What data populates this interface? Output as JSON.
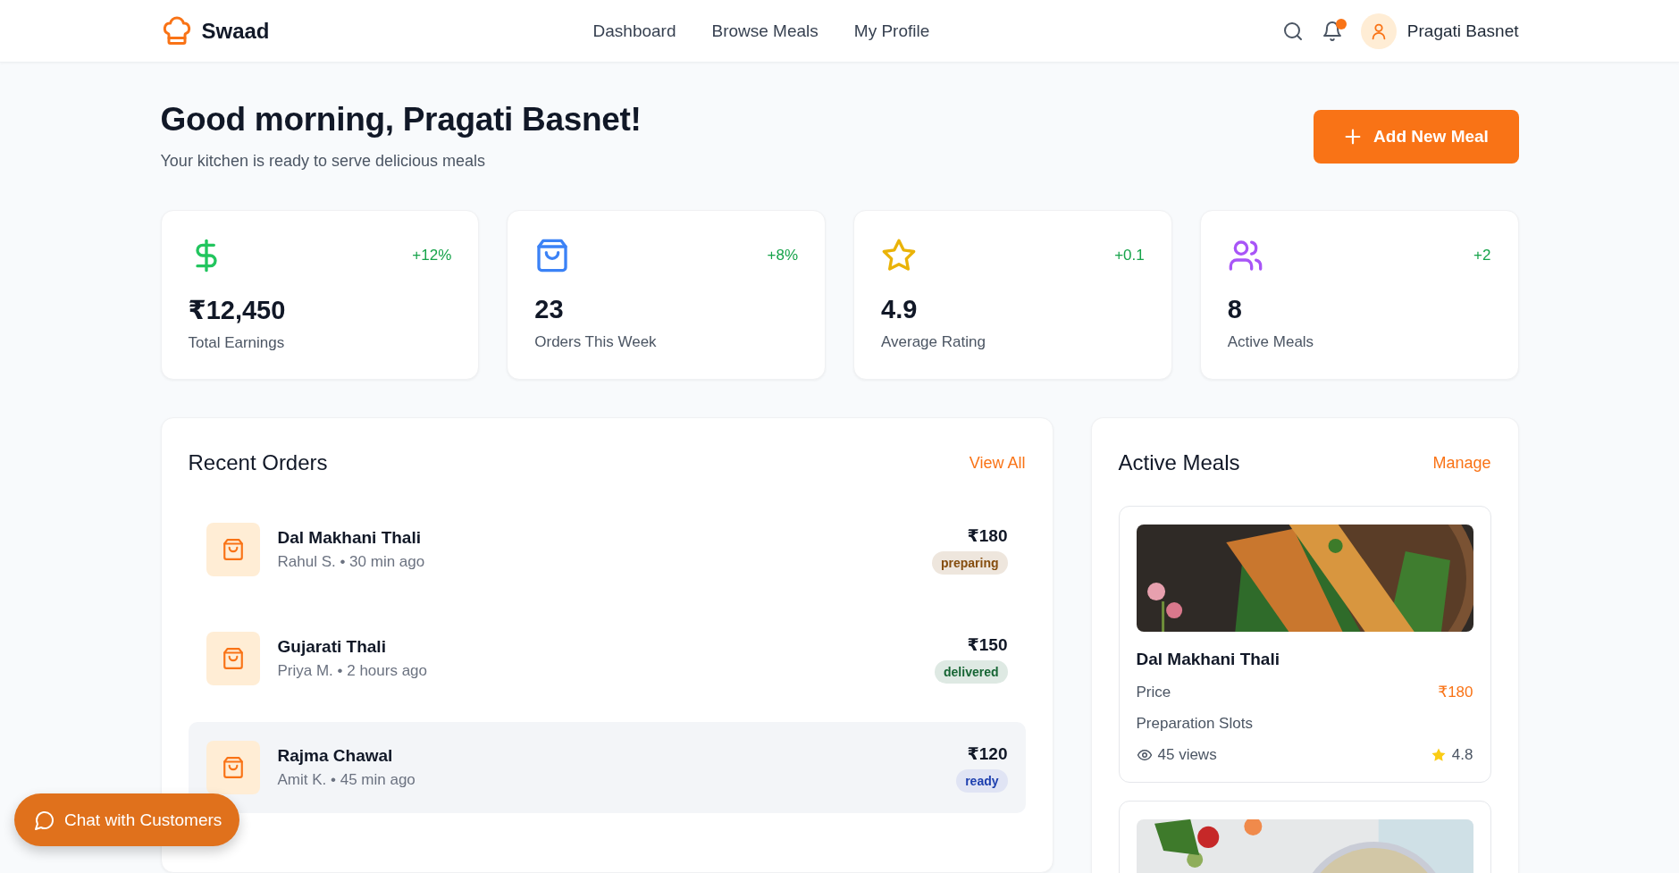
{
  "header": {
    "brand": "Swaad",
    "nav": [
      {
        "label": "Dashboard",
        "selected": false
      },
      {
        "label": "Browse Meals",
        "selected": false
      },
      {
        "label": "My Profile",
        "selected": false
      }
    ],
    "notification": true,
    "user": "Pragati Basnet"
  },
  "greeting": {
    "title": "Good morning, Pragati Basnet!",
    "subtitle": "Your kitchen is ready to serve delicious meals",
    "button": "Add New Meal"
  },
  "stats": [
    {
      "kind": "money",
      "color": "#22c55e",
      "change": "+12%",
      "value": "₹12,450",
      "label": "Total Earnings"
    },
    {
      "kind": "bag",
      "color": "#3b82f6",
      "change": "+8%",
      "value": "23",
      "label": "Orders This Week"
    },
    {
      "kind": "star",
      "color": "#eab308",
      "change": "+0.1",
      "value": "4.9",
      "label": "Average Rating"
    },
    {
      "kind": "people",
      "color": "#a855f7",
      "change": "+2",
      "value": "8",
      "label": "Active Meals"
    }
  ],
  "recent_orders": {
    "title": "Recent Orders",
    "link": "View All",
    "orders": [
      {
        "meal": "Dal Makhani Thali",
        "detail": "Rahul S. • 30 min ago",
        "price": "₹180",
        "status": "preparing",
        "color": "#854d0e",
        "selected": false
      },
      {
        "meal": "Gujarati Thali",
        "detail": "Priya M. • 2 hours ago",
        "price": "₹150",
        "status": "delivered",
        "color": "#166534",
        "selected": false
      },
      {
        "meal": "Rajma Chawal",
        "detail": "Amit K. • 45 min ago",
        "price": "₹120",
        "status": "ready",
        "color": "#1e40af",
        "selected": true
      }
    ]
  },
  "active_meals": {
    "title": "Active Meals",
    "link": "Manage",
    "meals": [
      {
        "kind": "details",
        "name": "Dal Makhani Thali",
        "price_label": "Price",
        "price": "₹180",
        "slots_label": "Preparation Slots",
        "views": "45 views",
        "rating": "4.8"
      },
      {
        "kind": "picture"
      }
    ]
  },
  "chat_button": "Chat with Customers"
}
